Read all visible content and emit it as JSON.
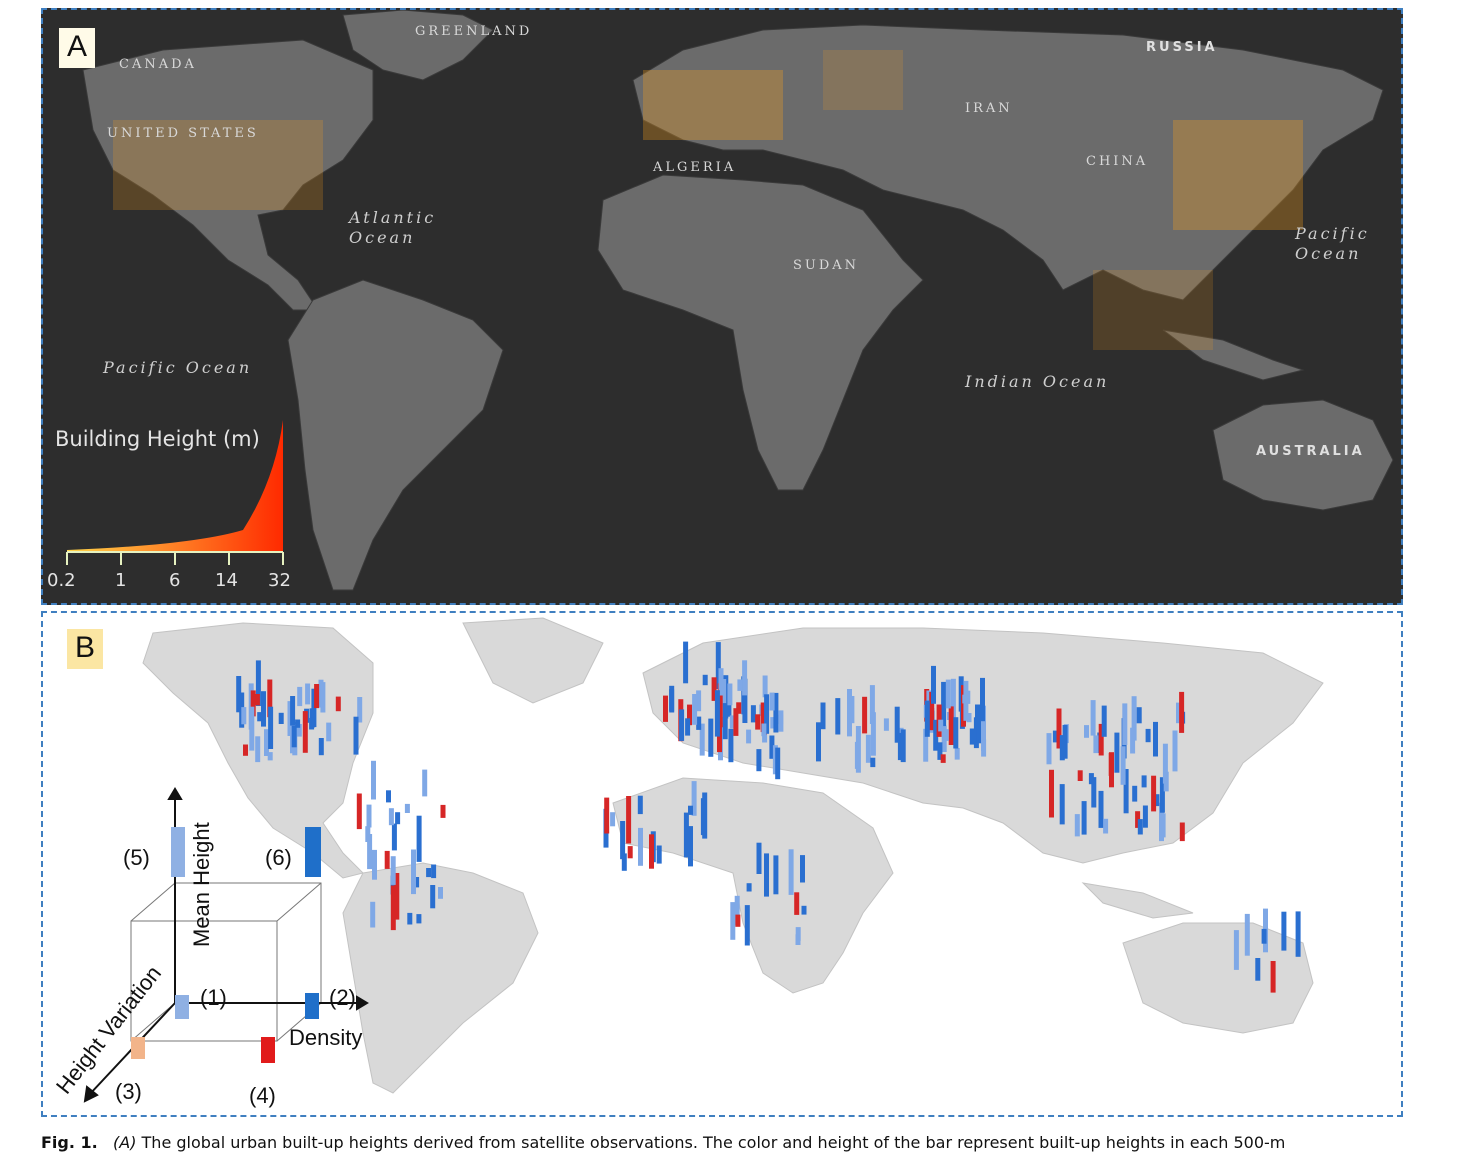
{
  "panel_a": {
    "label": "A",
    "places": {
      "greenland": "GREENLAND",
      "canada": "CANADA",
      "united_states": "UNITED STATES",
      "russia": "RUSSIA",
      "iran": "IRAN",
      "china": "CHINA",
      "algeria": "ALGERIA",
      "sudan": "SUDAN",
      "australia": "AUSTRALIA"
    },
    "oceans": {
      "atlantic_1": "Atlantic",
      "atlantic_2": "Ocean",
      "pacific_west": "Pacific Ocean",
      "pacific_east_1": "Pacific",
      "pacific_east_2": "Ocean",
      "indian": "Indian Ocean"
    },
    "legend": {
      "title": "Building Height (m)",
      "ticks": [
        "0.2",
        "1",
        "6",
        "14",
        "32"
      ],
      "color_low": "#ffd54a",
      "color_high": "#ff2a00"
    },
    "colors": {
      "background": "#2d2d2d",
      "land": "#6b6b6b"
    }
  },
  "panel_b": {
    "label": "B",
    "inset": {
      "y_axis": "Mean Height",
      "x_axis": "Density",
      "z_axis": "Height Variation",
      "categories": [
        {
          "id": "(1)",
          "color": "#8fb0e3"
        },
        {
          "id": "(2)",
          "color": "#1f6fc9"
        },
        {
          "id": "(3)",
          "color": "#f2b48a"
        },
        {
          "id": "(4)",
          "color": "#e11b1b"
        },
        {
          "id": "(5)",
          "color": "#8fb0e3"
        },
        {
          "id": "(6)",
          "color": "#1f6fc9"
        }
      ]
    },
    "colors": {
      "land": "#d9d9d9",
      "bar_blue": "#2a6fd0",
      "bar_light": "#7fa8e6",
      "bar_red": "#d62626"
    }
  },
  "caption": {
    "fig": "Fig. 1.",
    "panel_ref": "(A)",
    "text": "The global urban built-up heights derived from satellite observations. The color and height of the bar represent built-up heights in each 500-m"
  }
}
